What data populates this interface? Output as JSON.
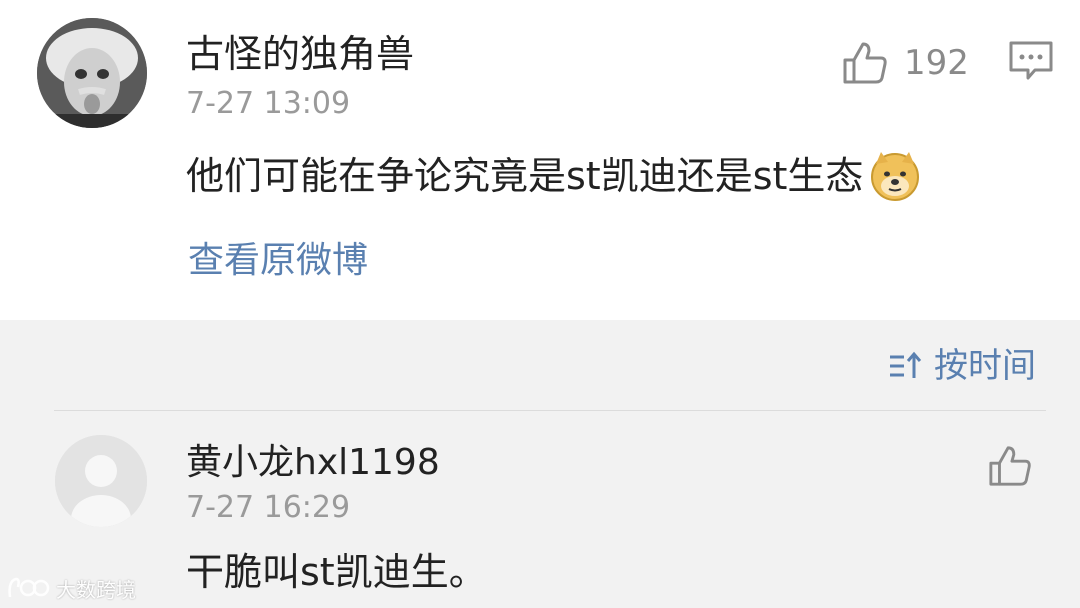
{
  "top_comment": {
    "username": "古怪的独角兽",
    "time": "7-27 13:09",
    "like_count": "192",
    "content": "他们可能在争论究竟是st凯迪还是st生态",
    "emoji_icon": "doge-emoji-icon",
    "view_original_label": "查看原微博"
  },
  "sort": {
    "label": "按时间",
    "icon": "sort-icon"
  },
  "reply": {
    "username": "黄小龙hxl1198",
    "time": "7-27 16:29",
    "content": "干脆叫st凯迪生。"
  },
  "watermark": {
    "text": "大数跨境"
  },
  "colors": {
    "link_blue": "#5a80b0",
    "meta_gray": "#9a9a9a",
    "background": "#f2f2f2"
  }
}
